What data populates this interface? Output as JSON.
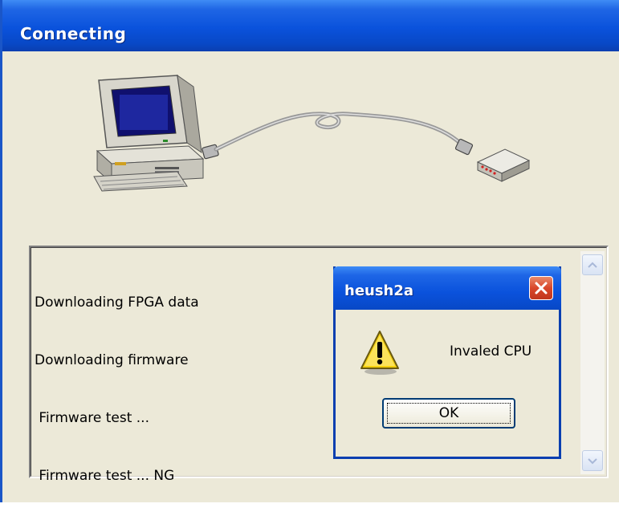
{
  "window": {
    "title": "Connecting"
  },
  "log": {
    "lines": [
      "Downloading FPGA data",
      "Downloading firmware",
      " Firmware test ...",
      " Firmware test ... NG"
    ]
  },
  "dialog": {
    "title": "heush2a",
    "message": "Invaled CPU",
    "ok_label": "OK",
    "icon": "warning-icon"
  },
  "icons": {
    "computer": "computer-icon",
    "cable": "cable-icon",
    "device": "device-icon",
    "scroll_up": "scroll-up-icon",
    "scroll_down": "scroll-down-icon",
    "close": "close-icon"
  },
  "colors": {
    "titlebar": "#0a52dc",
    "face": "#ece9d8",
    "close": "#d9472a",
    "warning": "#f5d10e"
  }
}
